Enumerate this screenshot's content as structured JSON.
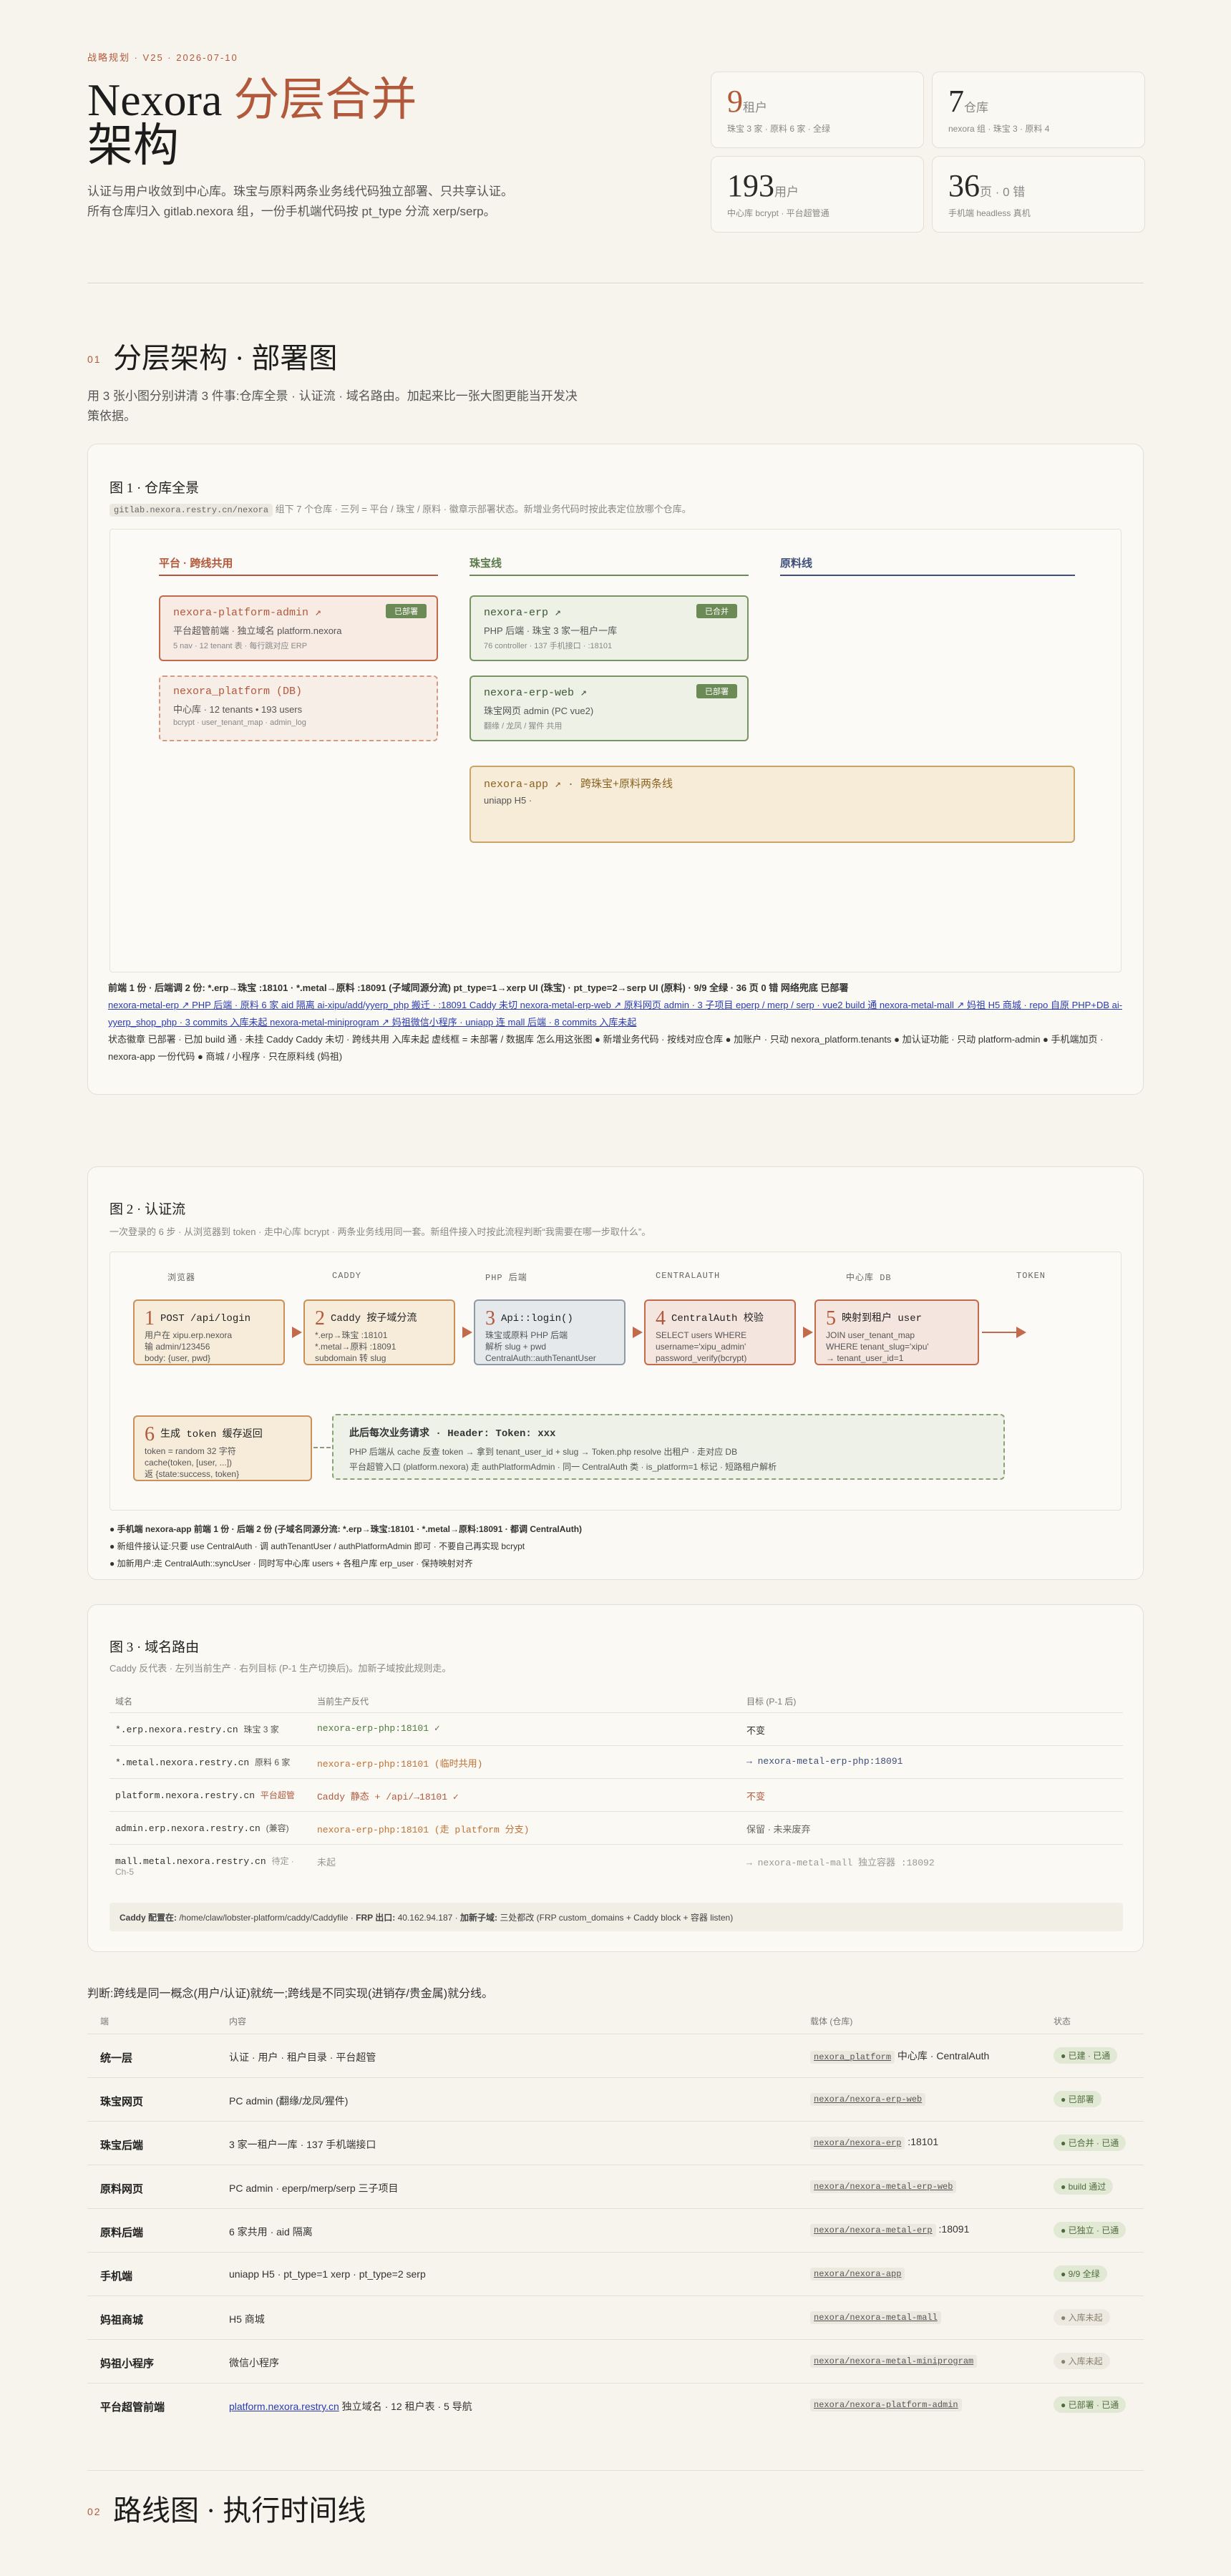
{
  "header": {
    "eyebrow": "战略规划 · V25 · 2026-07-10",
    "title_a": "Nexora ",
    "title_accent": "分层合并",
    "title_b": "架构",
    "desc": "认证与用户收敛到中心库。珠宝与原料两条业务线代码独立部署、只共享认证。所有仓库归入 gitlab.nexora 组，一份手机端代码按 pt_type 分流 xerp/serp。"
  },
  "stats": [
    {
      "num": "9",
      "unit": "租户",
      "sub": "珠宝 3 家 · 原料 6 家 · 全绿"
    },
    {
      "num": "7",
      "unit": "仓库",
      "sub": "nexora 组 · 珠宝 3 · 原料 4"
    },
    {
      "num": "193",
      "unit": "用户",
      "sub": "中心库 bcrypt · 平台超管通"
    },
    {
      "num": "36",
      "unit": "页 · 0 错",
      "sub": "手机端 headless 真机"
    }
  ],
  "sec1": {
    "no": "01",
    "title": "分层架构 · 部署图",
    "desc": "用 3 张小图分别讲清 3 件事:仓库全景 · 认证流 · 域名路由。加起来比一张大图更能当开发决策依据。"
  },
  "fig1": {
    "title": "图 1 · 仓库全景",
    "tag": "gitlab.nexora.restry.cn/nexora",
    "sub": "组下 7 个仓库 · 三列 = 平台 / 珠宝 / 原料 · 徽章示部署状态。新增业务代码时按此表定位放哪个仓库。",
    "col_platform": "平台 · 跨线共用",
    "col_jewelry": "珠宝线",
    "col_metal": "原料线",
    "boxes": {
      "pa": {
        "title": "nexora-platform-admin ↗",
        "pill": "已部署",
        "desc": "平台超管前端 · 独立域名 platform.nexora",
        "sub": "5 nav · 12 tenant 表 · 每行跳对应 ERP"
      },
      "pdb": {
        "title": "nexora_platform (DB)",
        "desc": "中心库 · 12 tenants • 193 users",
        "sub": "bcrypt · user_tenant_map · admin_log"
      },
      "erp": {
        "title": "nexora-erp ↗",
        "pill": "已合并",
        "desc": "PHP 后端 · 珠宝 3 家一租户一库",
        "sub": "76 controller · 137 手机接口 · :18101"
      },
      "erpweb": {
        "title": "nexora-erp-web ↗",
        "pill": "已部署",
        "desc": "珠宝网页 admin (PC vue2)",
        "sub": "翻缘 / 龙凤 / 猩件 共用"
      },
      "app": {
        "title": "nexora-app ↗ · 跨珠宝+原料两条线",
        "desc": "uniapp H5 ·"
      }
    },
    "legend1": "前端 1 份 · 后端调 2 份: *.erp→珠宝 :18101 · *.metal→原料 :18091 (子域同源分流) pt_type=1→xerp UI (珠宝) · pt_type=2→serp UI (原料) · 9/9 全绿 · 36 页 0 错 网络兜底 已部署",
    "legend2": "nexora-metal-erp ↗ PHP 后端 · 原料 6 家 aid 隔离 ai-xipu/add/yyerp_php 搬迁 · :18091 Caddy 未切 nexora-metal-erp-web ↗ 原料网页 admin · 3 子项目 eperp / merp / serp · vue2 build 通 nexora-metal-mall ↗ 妈祖 H5 商城 · repo 自原 PHP+DB ai-yyerp_shop_php · 3 commits 入库未起 nexora-metal-miniprogram ↗ 妈祖微信小程序 · uniapp 连 mall 后端 · 8 commits 入库未起",
    "legend3": "状态徽章 已部署 · 已加 build 通 · 未挂 Caddy Caddy 未切 · 跨线共用 入库未起 虚线框 = 未部署 / 数据库 怎么用这张图 ● 新增业务代码 · 按线对应仓库 ● 加账户 · 只动 nexora_platform.tenants ● 加认证功能 · 只动 platform-admin ● 手机端加页 · nexora-app 一份代码 ● 商城 / 小程序 · 只在原料线 (妈祖)"
  },
  "fig2": {
    "title": "图 2 · 认证流",
    "sub": "一次登录的 6 步 · 从浏览器到 token · 走中心库 bcrypt · 两条业务线用同一套。新组件接入时按此流程判断“我需要在哪一步取什么”。",
    "lanes": [
      "浏览器",
      "CADDY",
      "PHP 后端",
      "CENTRALAUTH",
      "中心库 DB",
      "TOKEN"
    ],
    "steps": [
      {
        "n": "1",
        "t": "POST /api/login",
        "l1": "用户在 xipu.erp.nexora",
        "l2": "输 admin/123456",
        "l3": "body: {user, pwd}"
      },
      {
        "n": "2",
        "t": "Caddy 按子域分流",
        "l1": "*.erp→珠宝 :18101",
        "l2": "*.metal→原料 :18091",
        "l3": "subdomain 转 slug"
      },
      {
        "n": "3",
        "t": "Api::login()",
        "l1": "珠宝或原料 PHP 后端",
        "l2": "解析 slug + pwd",
        "l3": "CentralAuth::authTenantUser"
      },
      {
        "n": "4",
        "t": "CentralAuth 校验",
        "l1": "SELECT users WHERE",
        "l2": "username='xipu_admin'",
        "l3": "password_verify(bcrypt)"
      },
      {
        "n": "5",
        "t": "映射到租户 user",
        "l1": "JOIN user_tenant_map",
        "l2": "WHERE tenant_slug='xipu'",
        "l3": "→ tenant_user_id=1"
      },
      {
        "n": "6",
        "t": "生成 token 缓存返回",
        "l1": "token = random 32 字符",
        "l2": "cache(token, [user, ...])",
        "l3": "返 {state:success, token}"
      }
    ],
    "next_title": "此后每次业务请求 · Header: Token: xxx",
    "next_l1": "PHP 后端从 cache 反查 token → 拿到 tenant_user_id + slug → Token.php resolve 出租户 · 走对应 DB",
    "next_l2": "平台超管入口 (platform.nexora) 走 authPlatformAdmin · 同一 CentralAuth 类 · is_platform=1 标记 · 短路租户解析",
    "notes": [
      "● 手机端 nexora-app 前端 1 份 · 后端 2 份 (子域名同源分流: *.erp→珠宝:18101 · *.metal→原料:18091 · 都调 CentralAuth)",
      "● 新组件接认证:只要 use CentralAuth · 调 authTenantUser / authPlatformAdmin 即可 · 不要自己再实现 bcrypt",
      "● 加新用户:走 CentralAuth::syncUser · 同时写中心库 users + 各租户库 erp_user · 保持映射对齐"
    ]
  },
  "fig3": {
    "title": "图 3 · 域名路由",
    "sub": "Caddy 反代表 · 左列当前生产 · 右列目标 (P-1 生产切换后)。加新子域按此规则走。",
    "heads": [
      "域名",
      "当前生产反代",
      "目标 (P-1 后)"
    ],
    "rows": [
      {
        "d": "*.erp.nexora.restry.cn",
        "dn": "珠宝 3 家",
        "c": "nexora-erp-php:18101 ✓",
        "t": "不变"
      },
      {
        "d": "*.metal.nexora.restry.cn",
        "dn": "原料 6 家",
        "c": "nexora-erp-php:18101 (临时共用)",
        "t": "→ nexora-metal-erp-php:18091"
      },
      {
        "d": "platform.nexora.restry.cn",
        "dn": "平台超管",
        "c": "Caddy 静态 + /api/→18101 ✓",
        "t": "不变"
      },
      {
        "d": "admin.erp.nexora.restry.cn",
        "dn": "(兼容)",
        "c": "nexora-erp-php:18101 (走 platform 分支)",
        "t": "保留 · 未来废弃"
      },
      {
        "d": "mall.metal.nexora.restry.cn",
        "dn": "待定 · Ch-5",
        "c": "未起",
        "t": "→ nexora-metal-mall 独立容器 :18092"
      }
    ],
    "footer_a": "Caddy 配置在:",
    "footer_b": " /home/claw/lobster-platform/caddy/Caddyfile · ",
    "footer_c": "FRP 出口:",
    "footer_d": " 40.162.94.187 · ",
    "footer_e": "加新子域:",
    "footer_f": " 三处都改 (FRP custom_domains + Caddy block + 容器 listen)"
  },
  "matrix": {
    "intro": "判断:跨线是同一概念(用户/认证)就统一;跨线是不同实现(进销存/贵金属)就分线。",
    "heads": [
      "端",
      "内容",
      "载体 (仓库)",
      "状态"
    ],
    "rows": [
      {
        "a": "统一层",
        "b": "认证 · 用户 · 租户目录 · 平台超管",
        "c": "nexora_platform",
        "c2": " 中心库 · CentralAuth",
        "s": "● 已建 · 已通",
        "ok": true,
        "link": false
      },
      {
        "a": "珠宝网页",
        "b": "PC admin (翻缘/龙凤/猩件)",
        "c": "nexora/nexora-erp-web",
        "c2": "",
        "s": "● 已部署",
        "ok": true,
        "link": false
      },
      {
        "a": "珠宝后端",
        "b": "3 家一租户一库 · 137 手机端接口",
        "c": "nexora/nexora-erp",
        "c2": " :18101",
        "s": "● 已合并 · 已通",
        "ok": true,
        "link": false
      },
      {
        "a": "原料网页",
        "b": "PC admin · eperp/merp/serp 三子项目",
        "c": "nexora/nexora-metal-erp-web",
        "c2": "",
        "s": "● build 通过",
        "ok": true,
        "link": false
      },
      {
        "a": "原料后端",
        "b": "6 家共用 · aid 隔离",
        "c": "nexora/nexora-metal-erp",
        "c2": " :18091",
        "s": "● 已独立 · 已通",
        "ok": true,
        "link": false
      },
      {
        "a": "手机端",
        "b": "uniapp H5 · pt_type=1 xerp · pt_type=2 serp",
        "c": "nexora/nexora-app",
        "c2": "",
        "s": "● 9/9 全绿",
        "ok": true,
        "link": false
      },
      {
        "a": "妈祖商城",
        "b": "H5 商城",
        "c": "nexora/nexora-metal-mall",
        "c2": "",
        "s": "● 入库未起",
        "ok": false,
        "link": false
      },
      {
        "a": "妈祖小程序",
        "b": "微信小程序",
        "c": "nexora/nexora-metal-miniprogram",
        "c2": "",
        "s": "● 入库未起",
        "ok": false,
        "link": false
      },
      {
        "a": "平台超管前端",
        "b": "platform.nexora.restry.cn",
        "b2": " 独立域名 · 12 租户表 · 5 导航",
        "c": "nexora/nexora-platform-admin",
        "c2": "",
        "s": "● 已部署 · 已通",
        "ok": true,
        "link": true
      }
    ]
  },
  "sec2": {
    "no": "02",
    "title": "路线图 · 执行时间线"
  }
}
